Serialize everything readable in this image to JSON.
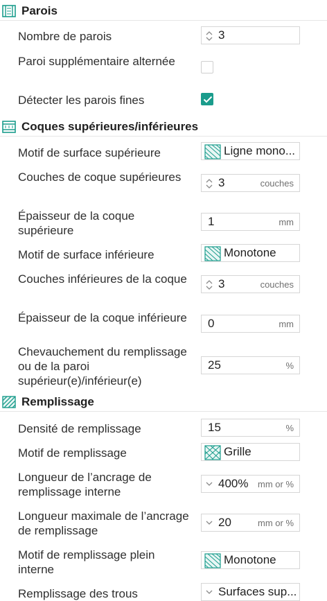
{
  "colors": {
    "accent": "#1a9c8c",
    "header_icon": "#1a9c8c",
    "border": "#d6d6d6"
  },
  "sections": {
    "walls": {
      "title": "Parois",
      "icon": "walls-section-icon",
      "wall_count": {
        "label": "Nombre de parois",
        "value": "3"
      },
      "alternating_wall": {
        "label": "Paroi supplémentaire alternée",
        "checked": false
      },
      "detect_thin_walls": {
        "label": "Détecter les parois fines",
        "checked": true
      }
    },
    "shells": {
      "title": "Coques supérieures/inférieures",
      "icon": "shells-section-icon",
      "top_pattern": {
        "label": "Motif de surface supérieure",
        "value": "Ligne mono..."
      },
      "top_layers": {
        "label": "Couches de coque supérieures",
        "value": "3",
        "unit": "couches"
      },
      "top_thickness": {
        "label": "Épaisseur de la coque supérieure",
        "value": "1",
        "unit": "mm"
      },
      "bottom_pattern": {
        "label": "Motif de surface inférieure",
        "value": "Monotone"
      },
      "bottom_layers": {
        "label": "Couches inférieures de la coque",
        "value": "3",
        "unit": "couches"
      },
      "bottom_thickness": {
        "label": "Épaisseur de la coque inférieure",
        "value": "0",
        "unit": "mm"
      },
      "overlap": {
        "label": "Chevauchement du remplissage ou de la paroi supérieur(e)/inférieur(e)",
        "value": "25",
        "unit": "%"
      }
    },
    "infill": {
      "title": "Remplissage",
      "icon": "infill-section-icon",
      "density": {
        "label": "Densité de remplissage",
        "value": "15",
        "unit": "%"
      },
      "pattern": {
        "label": "Motif de remplissage",
        "value": "Grille"
      },
      "anchor_length": {
        "label": "Longueur de l’ancrage de remplissage interne",
        "value": "400%",
        "unit": "mm or %"
      },
      "anchor_max": {
        "label": "Longueur maximale de l’ancrage de remplissage",
        "value": "20",
        "unit": "mm or %"
      },
      "solid_pattern": {
        "label": "Motif de remplissage plein interne",
        "value": "Monotone"
      },
      "gap_fill": {
        "label": "Remplissage des trous",
        "value": "Surfaces sup..."
      }
    }
  }
}
